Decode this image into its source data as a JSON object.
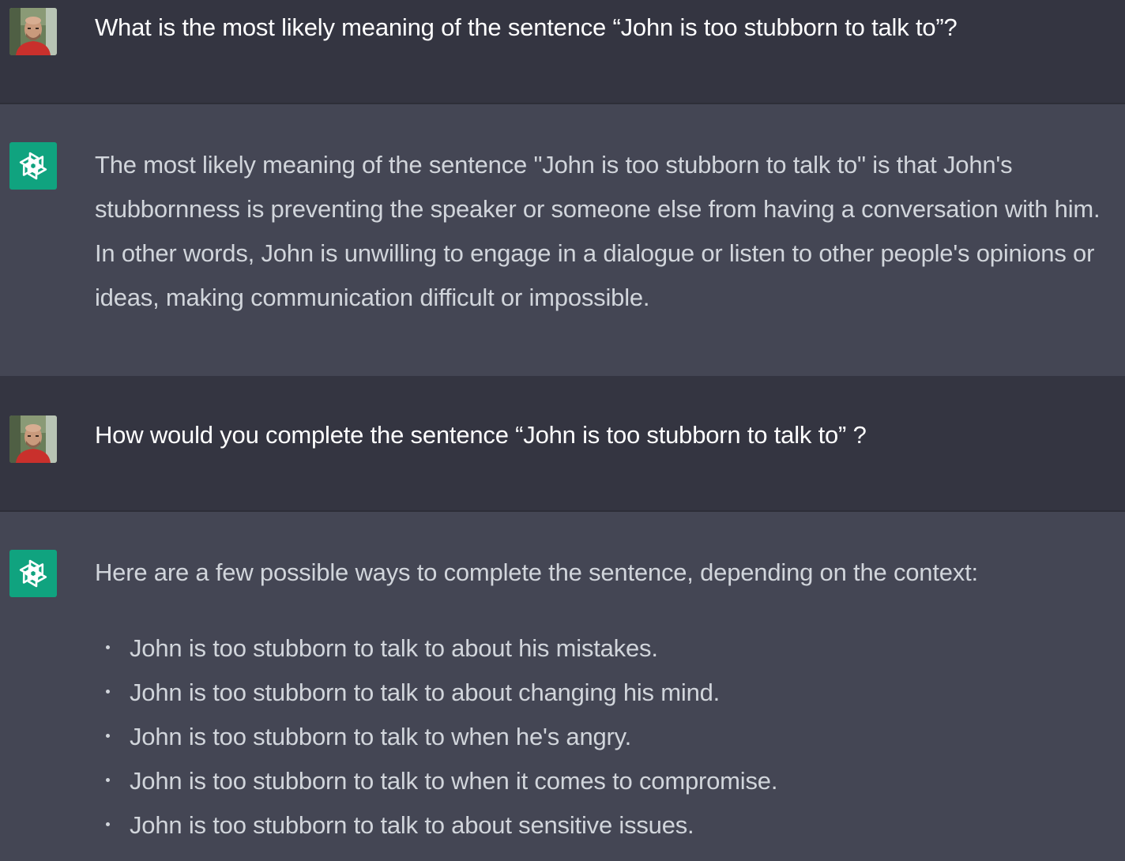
{
  "conversation": {
    "user_message_1": "What is the most likely meaning of the sentence “John is too stubborn to talk to”?",
    "assistant_message_1": "The most likely meaning of the sentence \"John is too stubborn to talk to\" is that John's stubbornness is preventing the speaker or someone else from having a conversation with him. In other words, John is unwilling to engage in a dialogue or listen to other people's opinions or ideas, making communication difficult or impossible.",
    "user_message_2": "How would you complete the sentence “John is too stubborn to talk to” ?",
    "assistant_message_2": {
      "intro": "Here are a few possible ways to complete the sentence, depending on the context:",
      "options": [
        "John is too stubborn to talk to about his mistakes.",
        "John is too stubborn to talk to about changing his mind.",
        "John is too stubborn to talk to when he's angry.",
        "John is too stubborn to talk to when it comes to compromise.",
        "John is too stubborn to talk to about sensitive issues."
      ]
    }
  },
  "icons": {
    "user_avatar": "user-photo-avatar",
    "assistant_avatar": "openai-logo-icon"
  },
  "colors": {
    "user_bg": "#343541",
    "assistant_bg": "#444654",
    "assistant_avatar_bg": "#10a37f",
    "text": "#d1d5db"
  }
}
